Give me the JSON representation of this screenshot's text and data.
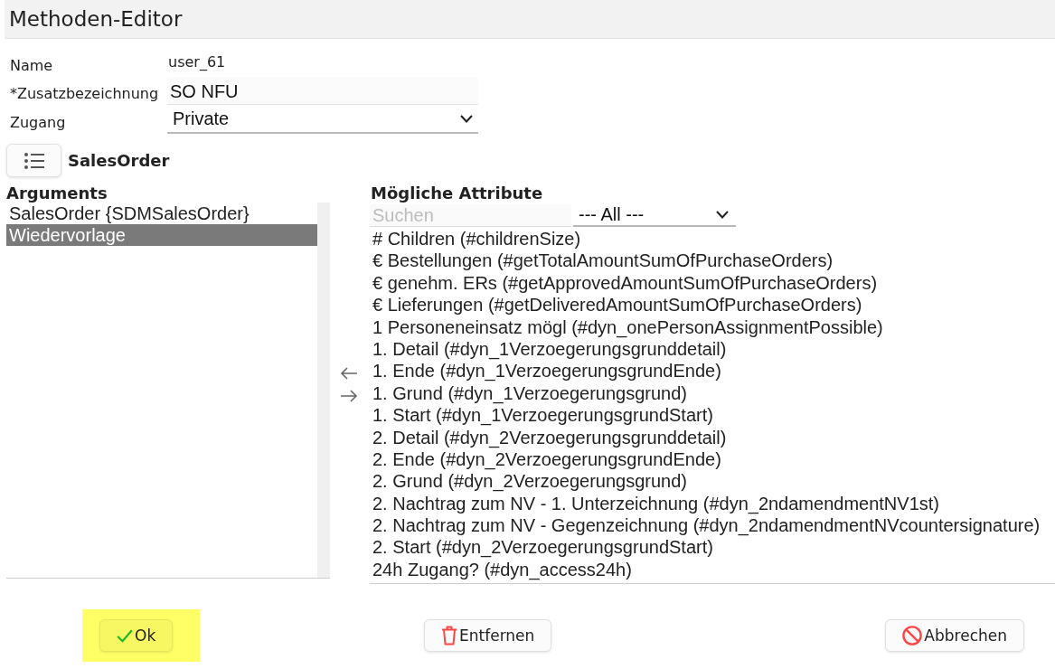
{
  "window": {
    "title": "Methoden-Editor"
  },
  "form": {
    "fields": [
      {
        "kind": "text",
        "label": "Name",
        "value": "user_61"
      },
      {
        "kind": "input",
        "label": "*Zusatzbezeichnung",
        "value": "SO NFU"
      },
      {
        "kind": "select",
        "label": "Zugang",
        "value": "Private"
      }
    ]
  },
  "class_bar": {
    "title": "SalesOrder"
  },
  "arguments": {
    "heading": "Arguments",
    "items": [
      {
        "label": "SalesOrder {SDMSalesOrder}",
        "selected": false
      },
      {
        "label": "Wiedervorlage",
        "selected": true
      }
    ]
  },
  "attributes": {
    "heading": "Mögliche Attribute",
    "search": {
      "placeholder": "Suchen"
    },
    "filter": {
      "value": "--- All ---"
    },
    "items": [
      {
        "label": "# Children (#childrenSize)",
        "selected": false
      },
      {
        "label": "€ Bestellungen (#getTotalAmountSumOfPurchaseOrders)",
        "selected": false
      },
      {
        "label": "€ genehm. ERs (#getApprovedAmountSumOfPurchaseOrders)",
        "selected": false
      },
      {
        "label": "€ Lieferungen (#getDeliveredAmountSumOfPurchaseOrders)",
        "selected": false
      },
      {
        "label": "1 Personeneinsatz mögl (#dyn_onePersonAssignmentPossible)",
        "selected": false
      },
      {
        "label": "1. Detail (#dyn_1Verzoegerungsgrunddetail)",
        "selected": false
      },
      {
        "label": "1. Ende (#dyn_1VerzoegerungsgrundEnde)",
        "selected": false
      },
      {
        "label": "1. Grund (#dyn_1Verzoegerungsgrund)",
        "selected": false
      },
      {
        "label": "1. Start (#dyn_1VerzoegerungsgrundStart)",
        "selected": false
      },
      {
        "label": "2. Detail (#dyn_2Verzoegerungsgrunddetail)",
        "selected": false
      },
      {
        "label": "2. Ende (#dyn_2VerzoegerungsgrundEnde)",
        "selected": false
      },
      {
        "label": "2. Grund (#dyn_2Verzoegerungsgrund)",
        "selected": false
      },
      {
        "label": "2. Nachtrag zum NV - 1. Unterzeichnung (#dyn_2ndamendmentNV1st)",
        "selected": false
      },
      {
        "label": "2. Nachtrag zum NV - Gegenzeichnung (#dyn_2ndamendmentNVcountersignature)",
        "selected": false
      },
      {
        "label": "2. Start (#dyn_2VerzoegerungsgrundStart)",
        "selected": false
      },
      {
        "label": "24h Zugang? (#dyn_access24h)",
        "selected": false
      }
    ]
  },
  "buttons": [
    {
      "kind": "ok",
      "label": "Ok",
      "highlighted": true
    },
    {
      "kind": "remove",
      "label": "Entfernen",
      "highlighted": false
    },
    {
      "kind": "cancel",
      "label": "Abbrechen",
      "highlighted": false
    }
  ]
}
